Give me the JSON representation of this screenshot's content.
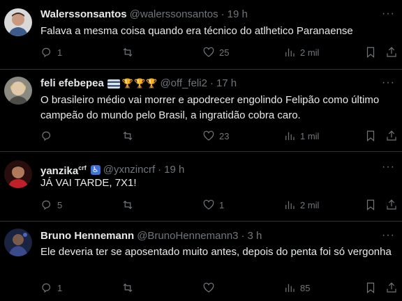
{
  "tweets": [
    {
      "name": "Walerssonsantos",
      "handle": "@walerssonsantos",
      "time": "19 h",
      "text": "Falava a mesma coisa quando era técnico do atlhetico Paranaense",
      "replies": "1",
      "retweets": "",
      "likes": "25",
      "views": "2 mil"
    },
    {
      "name": "feli efebepea",
      "handle": "@off_feli2",
      "time": "17 h",
      "text": "O brasileiro médio vai morrer e apodrecer engolindo Felipão como último campeão do mundo pelo Brasil, a ingratidão cobra caro.",
      "replies": "",
      "retweets": "",
      "likes": "23",
      "views": "1 mil"
    },
    {
      "name": "yanzika",
      "name_sup": "crf",
      "handle": "@yxnzincrf",
      "time": "19 h",
      "text": "JÁ VAI TARDE, 7X1!",
      "replies": "5",
      "retweets": "",
      "likes": "1",
      "views": "2 mil"
    },
    {
      "name": "Bruno Hennemann",
      "handle": "@BrunoHennemann3",
      "time": "3 h",
      "text": "Ele deveria ter se aposentado muito antes, depois do penta foi só vergonha",
      "replies": "1",
      "retweets": "",
      "likes": "",
      "views": "85"
    }
  ],
  "icons": {
    "reply": "reply-icon",
    "retweet": "retweet-icon",
    "like": "heart-icon",
    "views": "views-icon",
    "bookmark": "bookmark-icon",
    "share": "share-icon",
    "more": "more-icon"
  },
  "colors": {
    "background": "#000000",
    "text": "#e7e9ea",
    "secondary": "#71767b",
    "divider": "#2f3336"
  }
}
